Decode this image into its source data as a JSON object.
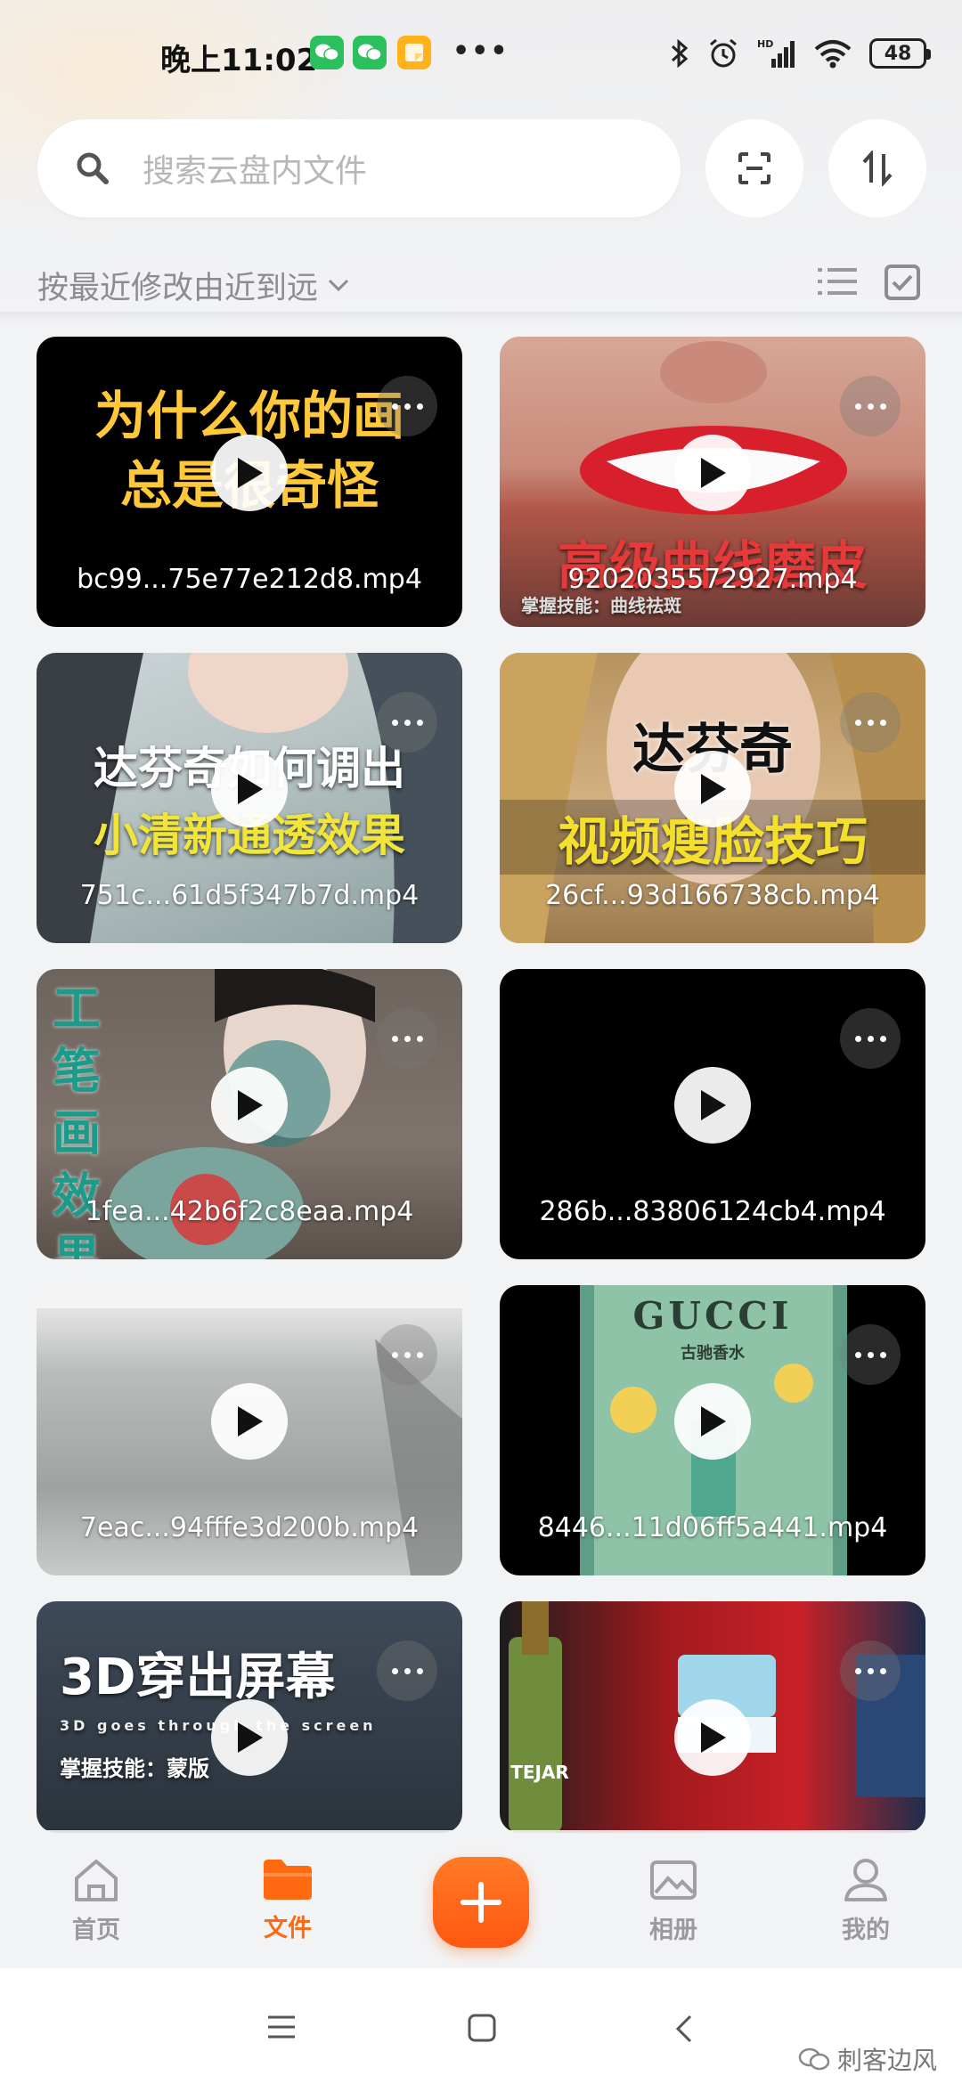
{
  "status_bar": {
    "time": "晚上11:02",
    "battery": "48",
    "network": "HD"
  },
  "search": {
    "placeholder": "搜索云盘内文件"
  },
  "sort": {
    "label": "按最近修改由近到远"
  },
  "files": [
    {
      "name": "bc99...75e77e212d8.mp4",
      "title_lines": [
        "为什么你的画",
        "总是很奇怪"
      ]
    },
    {
      "name": "9202035572927.mp4",
      "title_lines": [
        "高级曲线磨皮"
      ],
      "subtitle": "掌握技能：曲线祛斑"
    },
    {
      "name": "751c...61d5f347b7d.mp4",
      "title_lines": [
        "达芬奇如何调出",
        "小清新通透效果"
      ]
    },
    {
      "name": "26cf...93d166738cb.mp4",
      "title_lines": [
        "达芬奇",
        "视频瘦脸技巧"
      ]
    },
    {
      "name": "1fea...42b6f2c8eaa.mp4",
      "title_lines": [
        "工笔画效果"
      ]
    },
    {
      "name": "286b...83806124cb4.mp4",
      "title_lines": []
    },
    {
      "name": "7eac...94fffe3d200b.mp4",
      "title_lines": []
    },
    {
      "name": "8446...11d06ff5a441.mp4",
      "title_lines": [
        "GUCCI",
        "古驰香水"
      ]
    },
    {
      "name": "",
      "title_lines": [
        "3D穿出屏幕"
      ],
      "subtitle": "3D goes through the screen",
      "subtitle2": "掌握技能：蒙版"
    },
    {
      "name": "",
      "title_lines": [],
      "label": "TEJAR"
    }
  ],
  "tabs": [
    {
      "label": "首页",
      "icon": "home-icon"
    },
    {
      "label": "文件",
      "icon": "folder-icon",
      "active": true
    },
    {
      "label": "相册",
      "icon": "album-icon"
    },
    {
      "label": "我的",
      "icon": "profile-icon"
    }
  ],
  "watermark": "刺客边风",
  "colors": {
    "accent": "#ff6a10",
    "background": "#f2f3f5"
  }
}
